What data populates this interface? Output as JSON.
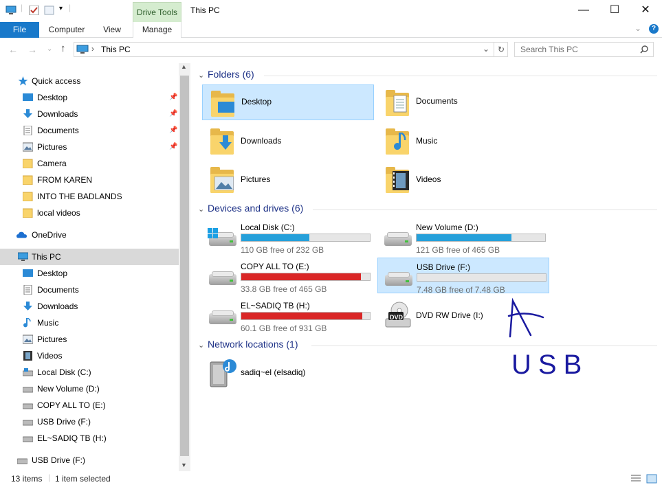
{
  "window": {
    "title": "This PC",
    "contextual_tab": "Drive Tools",
    "controls": {
      "minimize": "—",
      "maximize": "☐",
      "close": "✕"
    }
  },
  "ribbon": {
    "tabs": [
      "File",
      "Computer",
      "View",
      "Manage"
    ],
    "expand": "⌄",
    "help": "?"
  },
  "address": {
    "path": "This PC",
    "separator": "›",
    "dropdown": "⌄",
    "refresh": "↻",
    "search_placeholder": "Search This PC",
    "nav": {
      "back": "←",
      "forward": "→",
      "recent": "⌄",
      "up": "↑"
    }
  },
  "nav_pane": {
    "quick_access": {
      "label": "Quick access",
      "items": [
        {
          "label": "Desktop",
          "icon": "desktop-icon",
          "pinned": true
        },
        {
          "label": "Downloads",
          "icon": "downloads-icon",
          "pinned": true
        },
        {
          "label": "Documents",
          "icon": "documents-icon",
          "pinned": true
        },
        {
          "label": "Pictures",
          "icon": "pictures-icon",
          "pinned": true
        },
        {
          "label": "Camera",
          "icon": "folder-icon",
          "pinned": false
        },
        {
          "label": "FROM KAREN",
          "icon": "folder-icon",
          "pinned": false
        },
        {
          "label": "INTO THE BADLANDS",
          "icon": "folder-icon",
          "pinned": false
        },
        {
          "label": "local videos",
          "icon": "folder-icon",
          "pinned": false
        }
      ]
    },
    "onedrive": "OneDrive",
    "this_pc": {
      "label": "This PC",
      "items": [
        {
          "label": "Desktop",
          "icon": "desktop-icon"
        },
        {
          "label": "Documents",
          "icon": "documents-icon"
        },
        {
          "label": "Downloads",
          "icon": "downloads-icon"
        },
        {
          "label": "Music",
          "icon": "music-icon"
        },
        {
          "label": "Pictures",
          "icon": "pictures-icon"
        },
        {
          "label": "Videos",
          "icon": "videos-icon"
        },
        {
          "label": "Local Disk (C:)",
          "icon": "drive-icon"
        },
        {
          "label": "New Volume (D:)",
          "icon": "drive-icon"
        },
        {
          "label": "COPY ALL TO (E:)",
          "icon": "drive-icon"
        },
        {
          "label": "USB Drive (F:)",
          "icon": "drive-icon"
        },
        {
          "label": "EL~SADIQ TB (H:)",
          "icon": "drive-icon"
        }
      ]
    },
    "usb_root": "USB Drive (F:)"
  },
  "content": {
    "folders_header": "Folders (6)",
    "folders": [
      {
        "name": "Desktop",
        "selected": true
      },
      {
        "name": "Documents",
        "selected": false
      },
      {
        "name": "Downloads",
        "selected": false
      },
      {
        "name": "Music",
        "selected": false
      },
      {
        "name": "Pictures",
        "selected": false
      },
      {
        "name": "Videos",
        "selected": false
      }
    ],
    "devices_header": "Devices and drives (6)",
    "drives": [
      {
        "name": "Local Disk (C:)",
        "free": "110 GB free of 232 GB",
        "used_fraction": 0.53,
        "color": "#26a0da",
        "selected": false
      },
      {
        "name": "New Volume (D:)",
        "free": "121 GB free of 465 GB",
        "used_fraction": 0.74,
        "color": "#26a0da",
        "selected": false
      },
      {
        "name": "COPY ALL TO (E:)",
        "free": "33.8 GB free of 465 GB",
        "used_fraction": 0.93,
        "color": "#da2626",
        "selected": false
      },
      {
        "name": "USB Drive (F:)",
        "free": "7.48 GB free of 7.48 GB",
        "used_fraction": 0.0,
        "color": "#26a0da",
        "selected": true
      },
      {
        "name": "EL~SADIQ TB (H:)",
        "free": "60.1 GB free of 931 GB",
        "used_fraction": 0.94,
        "color": "#da2626",
        "selected": false
      },
      {
        "name": "DVD RW Drive (I:)",
        "free": "",
        "used_fraction": null,
        "color": "",
        "selected": false
      }
    ],
    "dvd_label": "DVD",
    "network_header": "Network locations (1)",
    "network": [
      {
        "name": "sadiq~el (elsadiq)"
      }
    ],
    "annotation": "USB"
  },
  "status": {
    "items": "13 items",
    "selected": "1 item selected"
  }
}
